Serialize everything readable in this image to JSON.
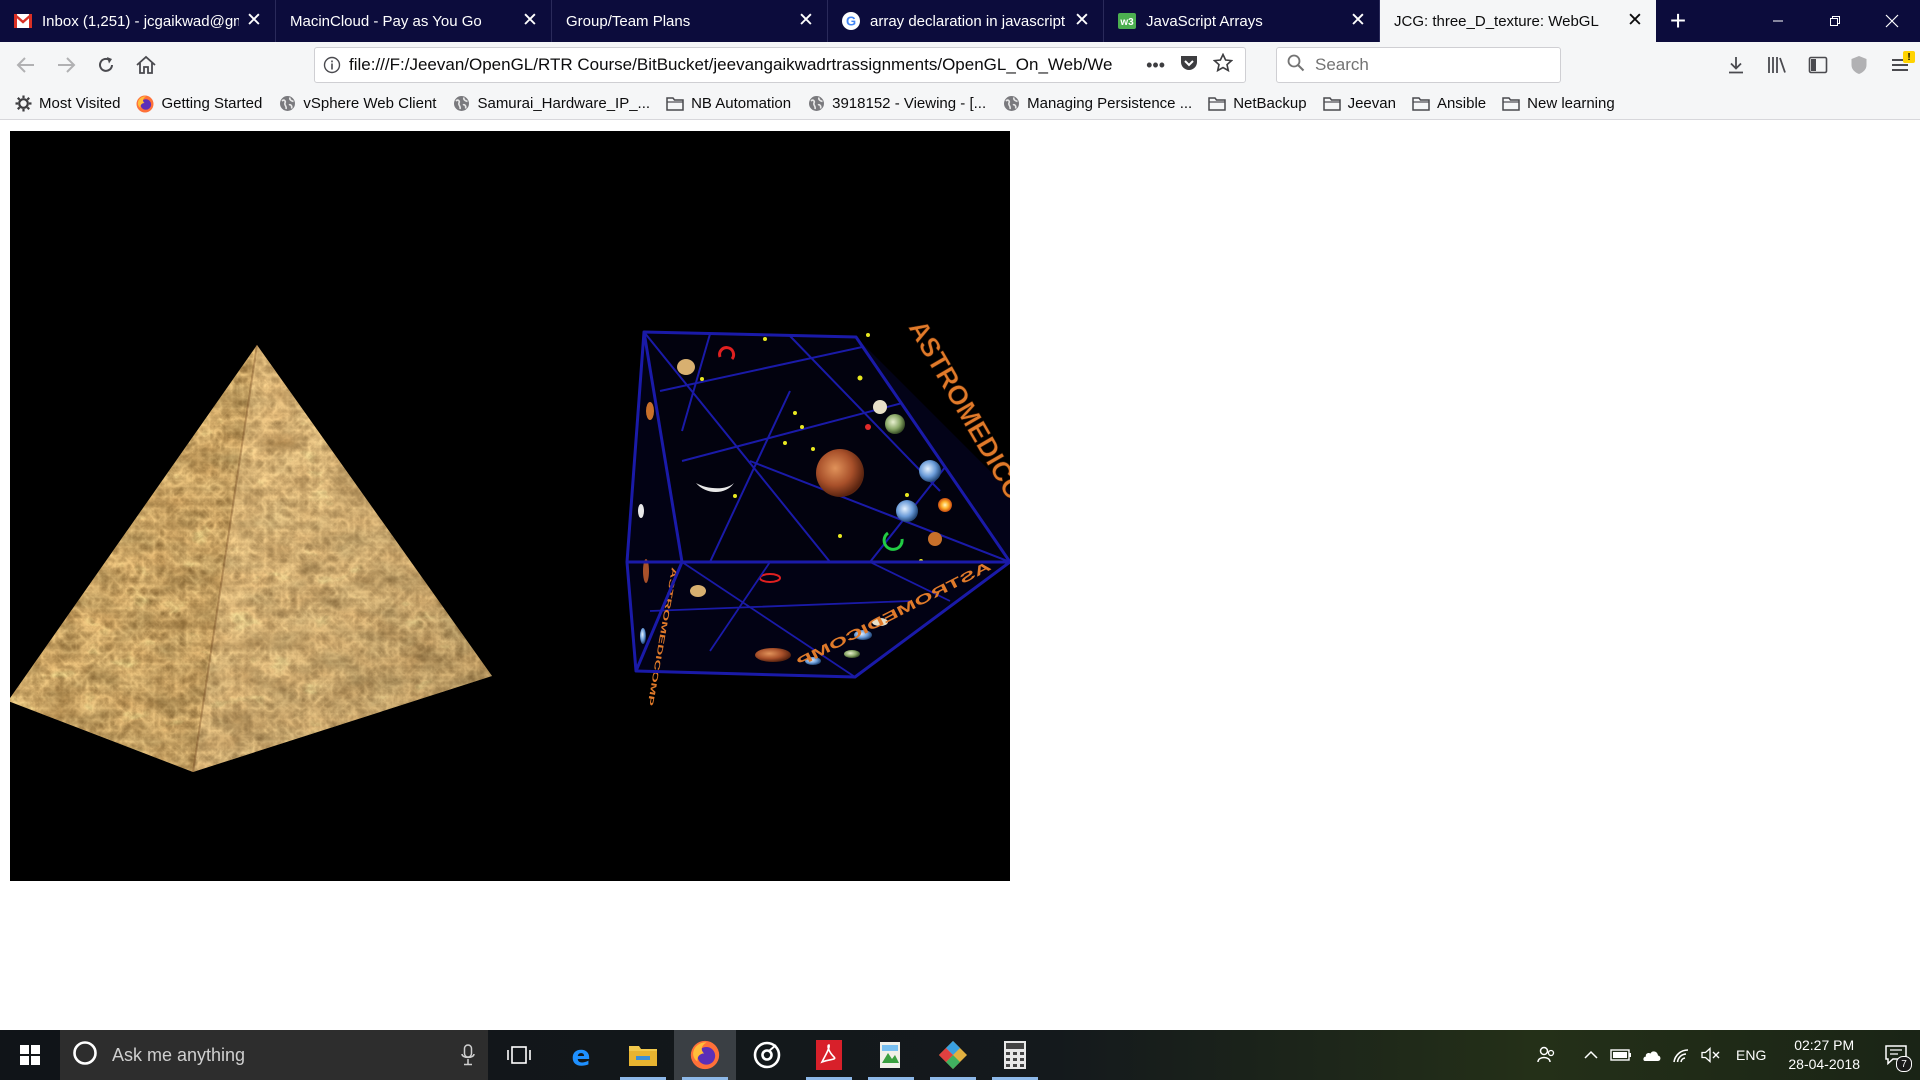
{
  "browser": {
    "tabs": [
      {
        "title": "Inbox (1,251) - jcgaikwad@gm",
        "icon": "gmail-icon",
        "active": false
      },
      {
        "title": "MacinCloud - Pay as You Go",
        "icon": "none",
        "active": false
      },
      {
        "title": "Group/Team Plans",
        "icon": "none",
        "active": false
      },
      {
        "title": "array declaration in javascript",
        "icon": "google-icon",
        "active": false
      },
      {
        "title": "JavaScript Arrays",
        "icon": "w3schools-icon",
        "active": false
      },
      {
        "title": "JCG: three_D_texture: WebGL",
        "icon": "none",
        "active": true
      }
    ],
    "new_tab_label": "+",
    "url": "file:///F:/Jeevan/OpenGL/RTR Course/BitBucket/jeevangaikwadrtrassignments/OpenGL_On_Web/We",
    "page_actions_label": "•••",
    "search_placeholder": "Search",
    "bookmarks": [
      {
        "label": "Most Visited",
        "icon": "gear-icon"
      },
      {
        "label": "Getting Started",
        "icon": "firefox-icon"
      },
      {
        "label": "vSphere Web Client",
        "icon": "globe-icon"
      },
      {
        "label": "Samurai_Hardware_IP_...",
        "icon": "globe-icon"
      },
      {
        "label": "NB Automation",
        "icon": "folder-icon"
      },
      {
        "label": "3918152 - Viewing - [...",
        "icon": "globe-icon"
      },
      {
        "label": "Managing Persistence ...",
        "icon": "globe-icon"
      },
      {
        "label": "NetBackup",
        "icon": "folder-icon"
      },
      {
        "label": "Jeevan",
        "icon": "folder-icon"
      },
      {
        "label": "Ansible",
        "icon": "folder-icon"
      },
      {
        "label": "New learning",
        "icon": "folder-icon"
      }
    ]
  },
  "scene": {
    "objects": [
      {
        "name": "pyramid",
        "texture": "stone"
      },
      {
        "name": "cube",
        "texture": "astronomy"
      }
    ],
    "cube_text": "ASTROMEDICOMP",
    "colors": {
      "background": "#000000",
      "stone_light": "#e6c283",
      "stone_dark": "#7a4a22",
      "cube_edge": "#1a1aa8",
      "cube_text": "#e07a2a"
    }
  },
  "taskbar": {
    "search_placeholder": "Ask me anything",
    "apps": [
      {
        "name": "task-view",
        "running": false,
        "active": false
      },
      {
        "name": "edge",
        "running": false,
        "active": false
      },
      {
        "name": "file-explorer",
        "running": true,
        "active": false
      },
      {
        "name": "firefox",
        "running": true,
        "active": true
      },
      {
        "name": "media-player",
        "running": false,
        "active": false
      },
      {
        "name": "acrobat-reader",
        "running": true,
        "active": false
      },
      {
        "name": "image-viewer",
        "running": true,
        "active": false
      },
      {
        "name": "dev-tool",
        "running": true,
        "active": false
      },
      {
        "name": "calculator",
        "running": true,
        "active": false
      }
    ],
    "language": "ENG",
    "time": "02:27 PM",
    "date": "28-04-2018",
    "notification_count": "7"
  }
}
